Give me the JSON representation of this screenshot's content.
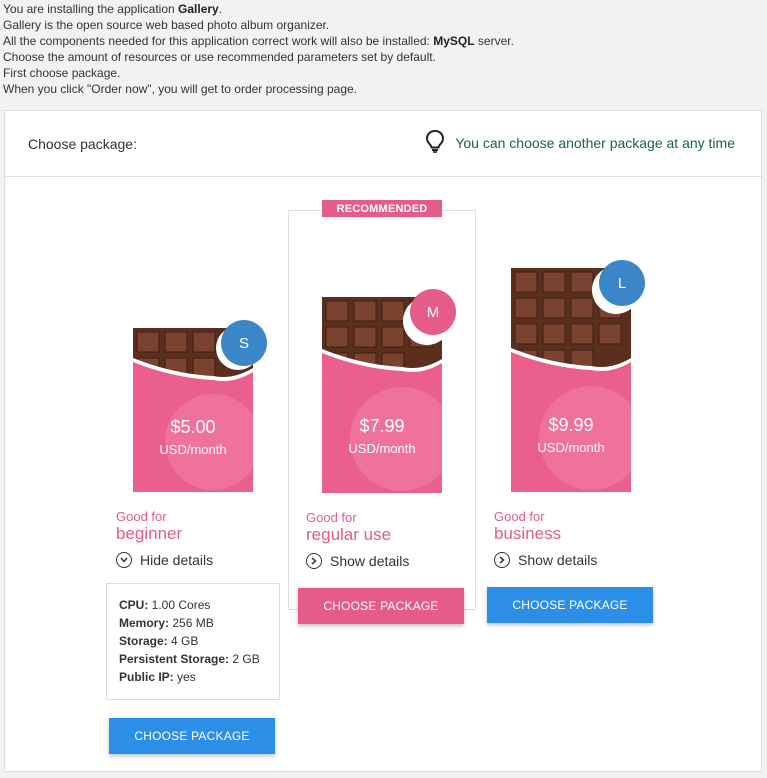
{
  "intro": {
    "line1_prefix": "You are installing the application ",
    "line1_app": "Gallery",
    "line1_suffix": ".",
    "line2": "Gallery is the open source web based photo album organizer.",
    "line3_prefix": "All the components needed for this application correct work will also be installed: ",
    "line3_component": "MySQL",
    "line3_suffix": " server.",
    "line4": "Choose the amount of resources or use recommended parameters set by default.",
    "line5": "First choose package.",
    "line6": "When you click \"Order now\", you will get to order processing page."
  },
  "header": {
    "title": "Choose package:",
    "hint": "You can choose another package at any time",
    "hint_icon": "lightbulb-icon"
  },
  "recommended_label": "RECOMMENDED",
  "packages": [
    {
      "size": "S",
      "price": "$5.00",
      "period": "USD/month",
      "good_for_label": "Good for",
      "good_for": "beginner",
      "toggle": "Hide details",
      "button": "CHOOSE PACKAGE",
      "badge_color": "#3a86c8",
      "button_color": "#2c8ee6",
      "details": {
        "cpu_label": "CPU:",
        "cpu": " 1.00 Cores",
        "memory_label": "Memory:",
        "memory": " 256 MB",
        "storage_label": "Storage:",
        "storage": " 4 GB",
        "pstorage_label": "Persistent Storage:",
        "pstorage": " 2 GB",
        "ip_label": "Public IP:",
        "ip": " yes"
      }
    },
    {
      "size": "M",
      "price": "$7.99",
      "period": "USD/month",
      "good_for_label": "Good for",
      "good_for": "regular use",
      "toggle": "Show details",
      "button": "CHOOSE PACKAGE",
      "badge_color": "#e55c8a",
      "button_color": "#e55c8a"
    },
    {
      "size": "L",
      "price": "$9.99",
      "period": "USD/month",
      "good_for_label": "Good for",
      "good_for": "business",
      "toggle": "Show details",
      "button": "CHOOSE PACKAGE",
      "badge_color": "#3a86c8",
      "button_color": "#2c8ee6"
    }
  ],
  "colors": {
    "accent_pink": "#e55c8a",
    "accent_blue": "#2c8ee6",
    "wrapper_pink": "#ea5f8c",
    "chocolate": "#5a2f1e",
    "hint_green": "#1e5f46"
  }
}
